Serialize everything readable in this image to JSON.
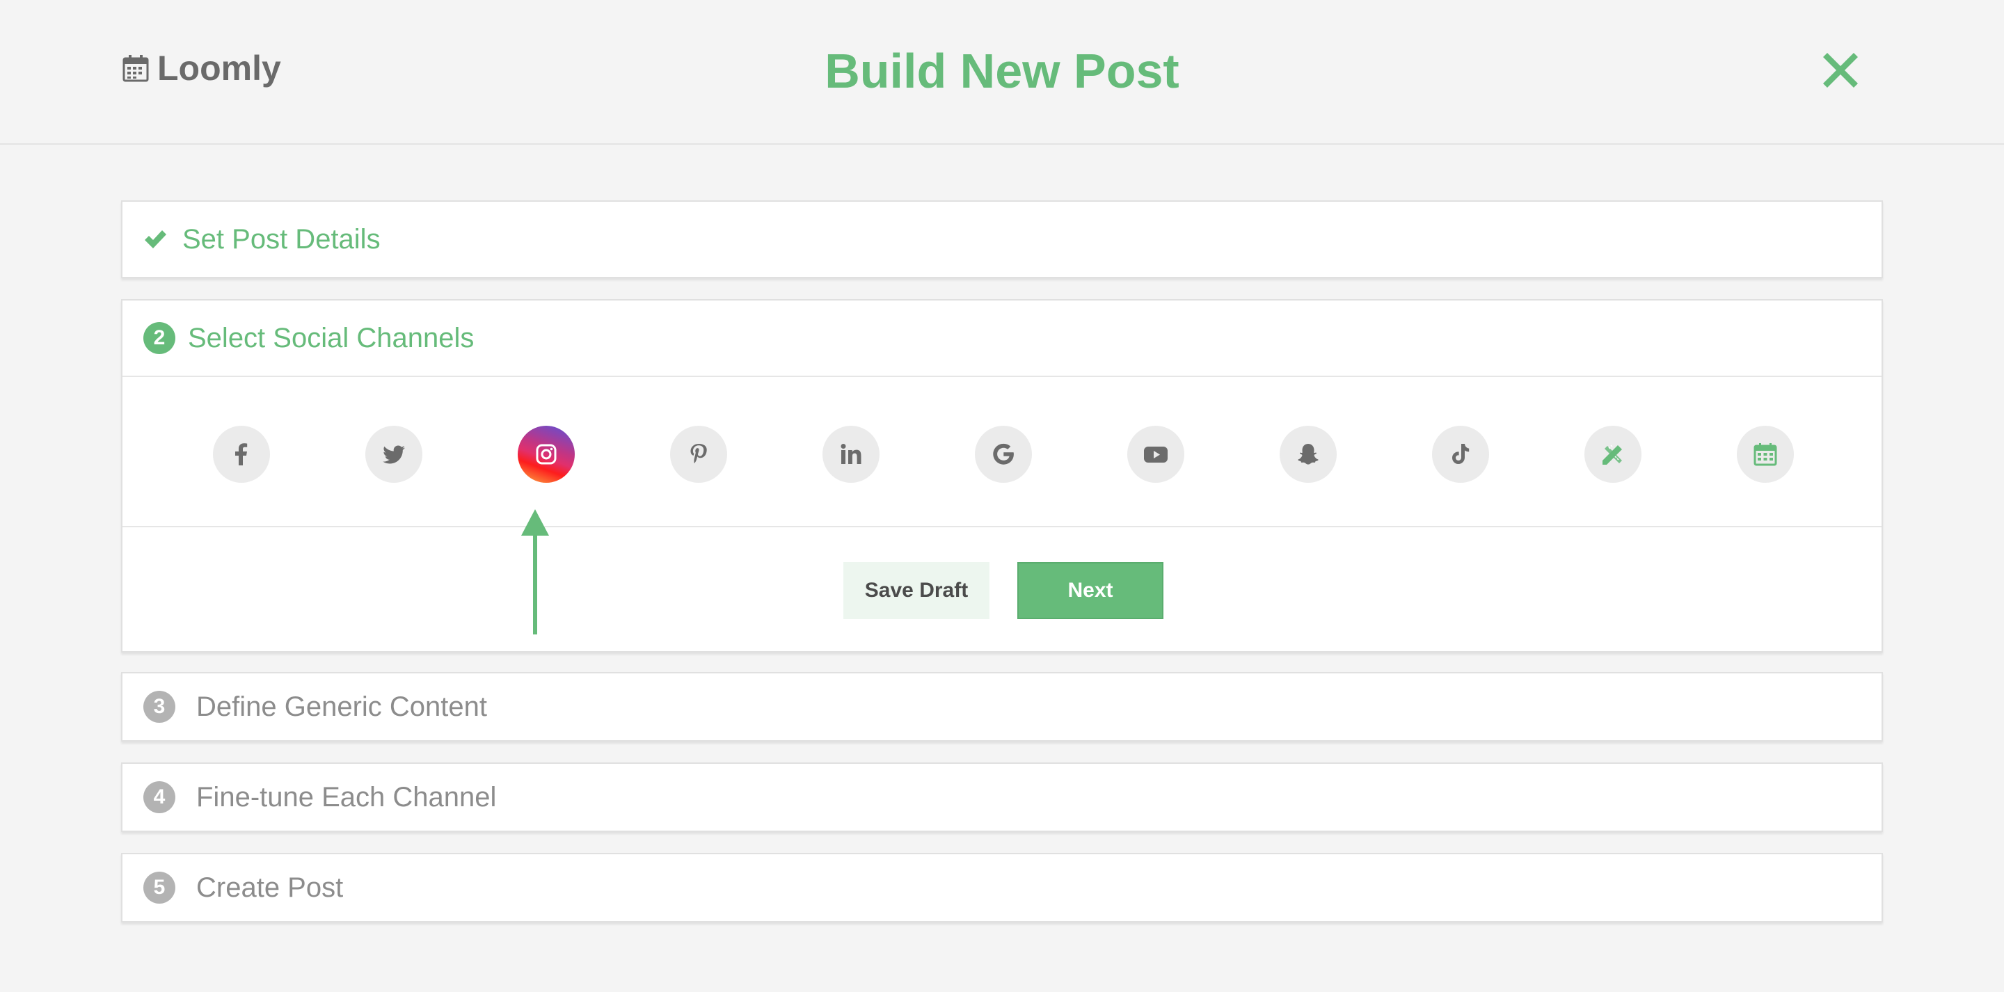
{
  "app": {
    "brand": "Loomly",
    "title": "Build New Post"
  },
  "icons": {
    "calendar": "calendar-icon",
    "close": "close-icon",
    "check": "check-icon",
    "arrow": "arrow-up-icon"
  },
  "colors": {
    "accent": "#66bb7a",
    "muted": "#8c8c8c",
    "icon": "#6b6b6b",
    "icon_bg": "#ebebeb"
  },
  "steps": [
    {
      "number": "",
      "label": "Set Post Details",
      "state": "done"
    },
    {
      "number": "2",
      "label": "Select Social Channels",
      "state": "active"
    },
    {
      "number": "3",
      "label": "Define Generic Content",
      "state": "pending"
    },
    {
      "number": "4",
      "label": "Fine-tune Each Channel",
      "state": "pending"
    },
    {
      "number": "5",
      "label": "Create Post",
      "state": "pending"
    }
  ],
  "channels": [
    {
      "name": "facebook",
      "icon": "facebook-icon",
      "selected": false
    },
    {
      "name": "twitter",
      "icon": "twitter-icon",
      "selected": false
    },
    {
      "name": "instagram",
      "icon": "instagram-icon",
      "selected": true
    },
    {
      "name": "pinterest",
      "icon": "pinterest-icon",
      "selected": false
    },
    {
      "name": "linkedin",
      "icon": "linkedin-icon",
      "selected": false
    },
    {
      "name": "google",
      "icon": "google-icon",
      "selected": false
    },
    {
      "name": "youtube",
      "icon": "youtube-icon",
      "selected": false
    },
    {
      "name": "snapchat",
      "icon": "snapchat-icon",
      "selected": false
    },
    {
      "name": "tiktok",
      "icon": "tiktok-icon",
      "selected": false
    },
    {
      "name": "custom-channel",
      "icon": "pencil-ruler-icon",
      "selected": false
    },
    {
      "name": "calendar-channel",
      "icon": "calendar-icon",
      "selected": false
    }
  ],
  "actions": {
    "save_draft": "Save Draft",
    "next": "Next"
  }
}
